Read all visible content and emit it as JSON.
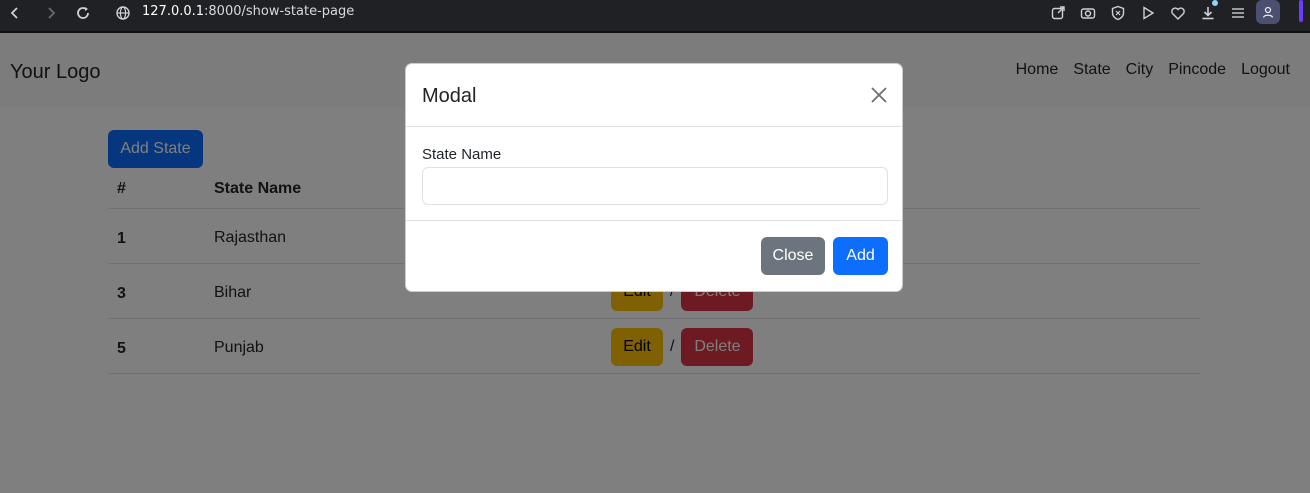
{
  "browser": {
    "url_host": "127.0.0.1",
    "url_rest": ":8000/show-state-page"
  },
  "navbar": {
    "logo": "Your Logo",
    "links": [
      "Home",
      "State",
      "City",
      "Pincode",
      "Logout"
    ]
  },
  "main": {
    "add_button": "Add State",
    "table": {
      "headers": [
        "#",
        "State Name"
      ],
      "rows": [
        {
          "num": "1",
          "name": "Rajasthan"
        },
        {
          "num": "3",
          "name": "Bihar"
        },
        {
          "num": "5",
          "name": "Punjab"
        }
      ],
      "edit_label": "Edit",
      "delete_label": "Delete",
      "separator": "/"
    }
  },
  "modal": {
    "title": "Modal",
    "field_label": "State Name",
    "field_value": "",
    "close_label": "Close",
    "add_label": "Add"
  },
  "colors": {
    "primary": "#0d6efd",
    "warning": "#ffc107",
    "danger": "#dc3545",
    "secondary": "#6c757d"
  }
}
